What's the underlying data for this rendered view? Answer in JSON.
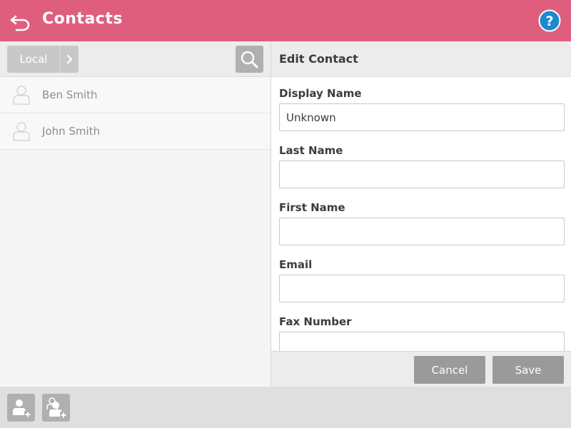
{
  "header": {
    "title": "Contacts",
    "back_icon": "back-arrow-icon",
    "help_icon": "help-icon",
    "background_color": "#df5e7e"
  },
  "left_pane": {
    "source_button_label": "Local",
    "source_arrow_icon": "chevron-right-icon",
    "search_icon": "search-icon",
    "contacts": [
      {
        "name": "Ben Smith",
        "icon": "person-icon"
      },
      {
        "name": "John Smith",
        "icon": "person-icon"
      }
    ]
  },
  "edit_contact": {
    "title": "Edit Contact",
    "fields": [
      {
        "label": "Display Name",
        "value": "Unknown"
      },
      {
        "label": "Last Name",
        "value": ""
      },
      {
        "label": "First Name",
        "value": ""
      },
      {
        "label": "Email",
        "value": ""
      },
      {
        "label": "Fax Number",
        "value": ""
      }
    ],
    "cancel_label": "Cancel",
    "save_label": "Save"
  },
  "bottom_bar": {
    "add_contact_icon": "add-contact-icon",
    "add_group_icon": "add-group-icon"
  }
}
